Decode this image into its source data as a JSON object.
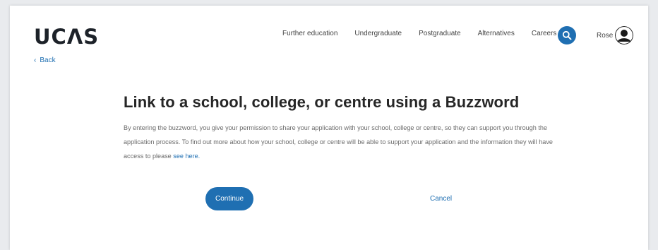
{
  "header": {
    "logo": "UCΛS",
    "nav": [
      "Further education",
      "Undergraduate",
      "Postgraduate",
      "Alternatives",
      "Careers"
    ],
    "search_icon": "search-icon",
    "user_name": "Rose",
    "avatar_icon": "user-avatar-icon"
  },
  "back": {
    "label": "Back",
    "icon": "chevron-left-icon"
  },
  "main": {
    "title": "Link to a school, college, or centre using a Buzzword",
    "description_1": "By entering the buzzword, you give your permission to share your application with your school, college or centre, so they can support you through the application process. To find out more about how your school, college or centre will be able to support your application and the information they will have access to please",
    "description_link": "see here.",
    "continue_label": "Continue",
    "cancel_label": "Cancel"
  },
  "colors": {
    "accent": "#1f6fb2",
    "background": "#e9ebee",
    "card": "#ffffff"
  }
}
